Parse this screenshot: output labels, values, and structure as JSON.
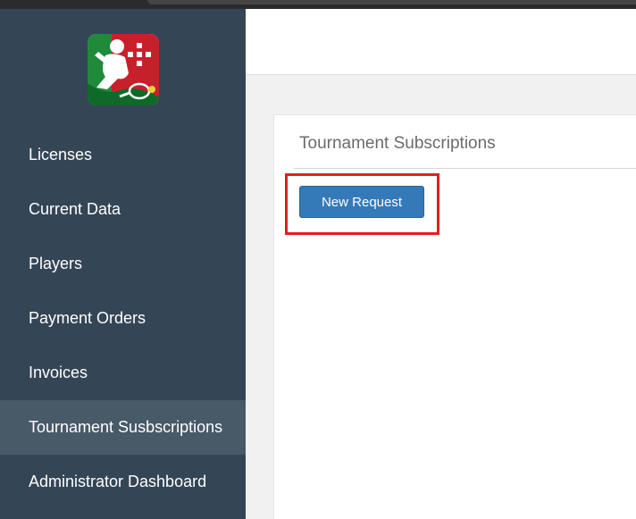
{
  "sidebar": {
    "logo_icon": "padel-federation-logo-icon",
    "items": [
      {
        "label": "Licenses",
        "active": false
      },
      {
        "label": "Current Data",
        "active": false
      },
      {
        "label": "Players",
        "active": false
      },
      {
        "label": "Payment Orders",
        "active": false
      },
      {
        "label": "Invoices",
        "active": false
      },
      {
        "label": "Tournament Susbscriptions",
        "active": true
      },
      {
        "label": "Administrator Dashboard",
        "active": false
      }
    ]
  },
  "main": {
    "panel_title": "Tournament Subscriptions",
    "new_request_label": "New Request"
  },
  "colors": {
    "sidebar_bg": "#344556",
    "sidebar_active_bg": "#485968",
    "button_bg": "#357ab8",
    "highlight_border": "#e0201f"
  }
}
